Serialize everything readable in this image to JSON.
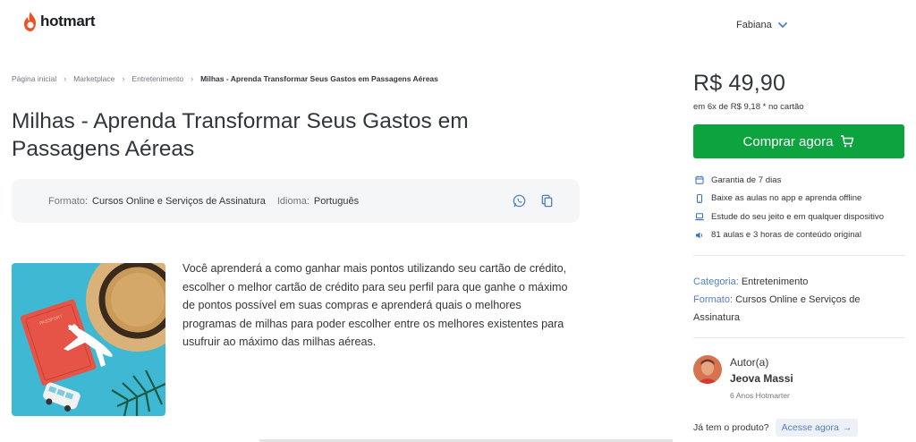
{
  "header": {
    "logo_text": "hotmart",
    "user_name": "Fabiana"
  },
  "breadcrumb": [
    {
      "label": "Página inicial"
    },
    {
      "label": "Marketplace"
    },
    {
      "label": "Entretenimento"
    },
    {
      "label": "Milhas - Aprenda Transformar Seus Gastos em Passagens Aéreas"
    }
  ],
  "product": {
    "title": "Milhas - Aprenda Transformar Seus Gastos em Passagens Aéreas",
    "format_label": "Formato:",
    "format_value": "Cursos Online e Serviços de Assinatura",
    "language_label": "Idioma:",
    "language_value": "Português",
    "description": "Você aprenderá a como ganhar mais pontos utilizando seu cartão de crédito, escolher o melhor cartão de crédito para seu perfil para que ganhe o máximo de pontos possível em suas compras e aprenderá quais o melhores programas de milhas para poder escolher entre os melhores existentes para usufruir ao máximo das milhas aéreas.",
    "image_passport_text": "PASSPORT"
  },
  "purchase": {
    "price": "R$ 49,90",
    "installments": "em 6x de R$ 9,18 * no cartão",
    "buy_label": "Comprar agora",
    "features": [
      {
        "icon": "calendar-icon",
        "text": "Garantia de 7 dias"
      },
      {
        "icon": "mobile-icon",
        "text": "Baixe as aulas no app e aprenda offline"
      },
      {
        "icon": "laptop-icon",
        "text": "Estude do seu jeito e em qualquer dispositivo"
      },
      {
        "icon": "volume-icon",
        "text": "81 aulas e 3 horas de conteúdo original"
      }
    ]
  },
  "meta": {
    "category_label": "Categoria:",
    "category_value": "Entretenimento",
    "format_label": "Formato:",
    "format_value": "Cursos Online e Serviços de Assinatura"
  },
  "author": {
    "label": "Autor(a)",
    "name": "Jeova Massi",
    "experience": "6 Anos Hotmarter"
  },
  "access": {
    "question": "Já tem o produto?",
    "button_label": "Acesse agora"
  },
  "colors": {
    "brand": "#f04e23",
    "buy": "#0da33f",
    "link": "#5281c2"
  }
}
